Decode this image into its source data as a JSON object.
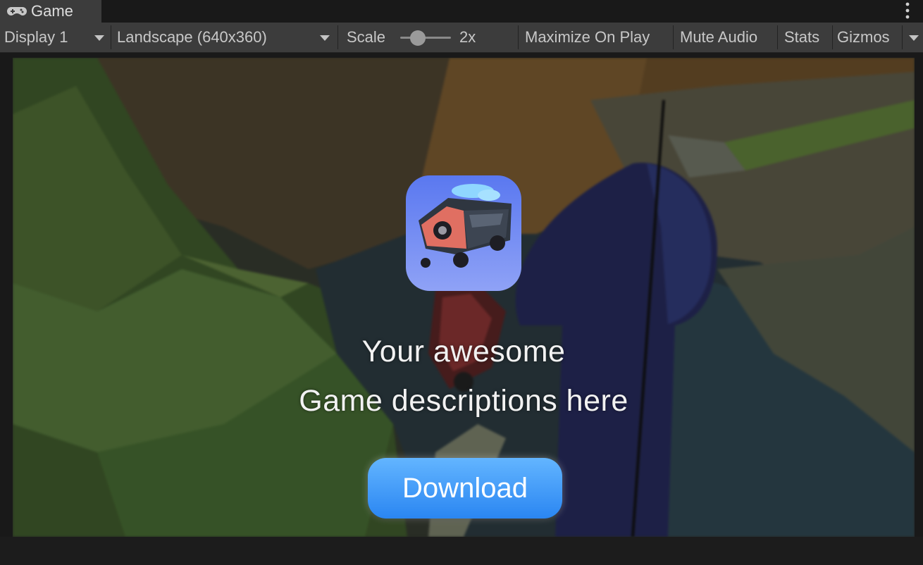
{
  "tab": {
    "title": "Game",
    "icon": "gamepad-icon"
  },
  "toolbar": {
    "display": "Display 1",
    "aspect": "Landscape (640x360)",
    "scale_label": "Scale",
    "scale_value": "2x",
    "scale_level": 0.35,
    "maximize": "Maximize On Play",
    "mute": "Mute Audio",
    "stats": "Stats",
    "gizmos": "Gizmos"
  },
  "overlay": {
    "icon": "car-game-app-icon",
    "description_line1": "Your awesome",
    "description_line2": "Game descriptions here",
    "download_label": "Download"
  },
  "colors": {
    "button": "#3a95f8",
    "toolbar_bg": "#3c3c3c",
    "app_icon_bg": "#6f86f2"
  }
}
